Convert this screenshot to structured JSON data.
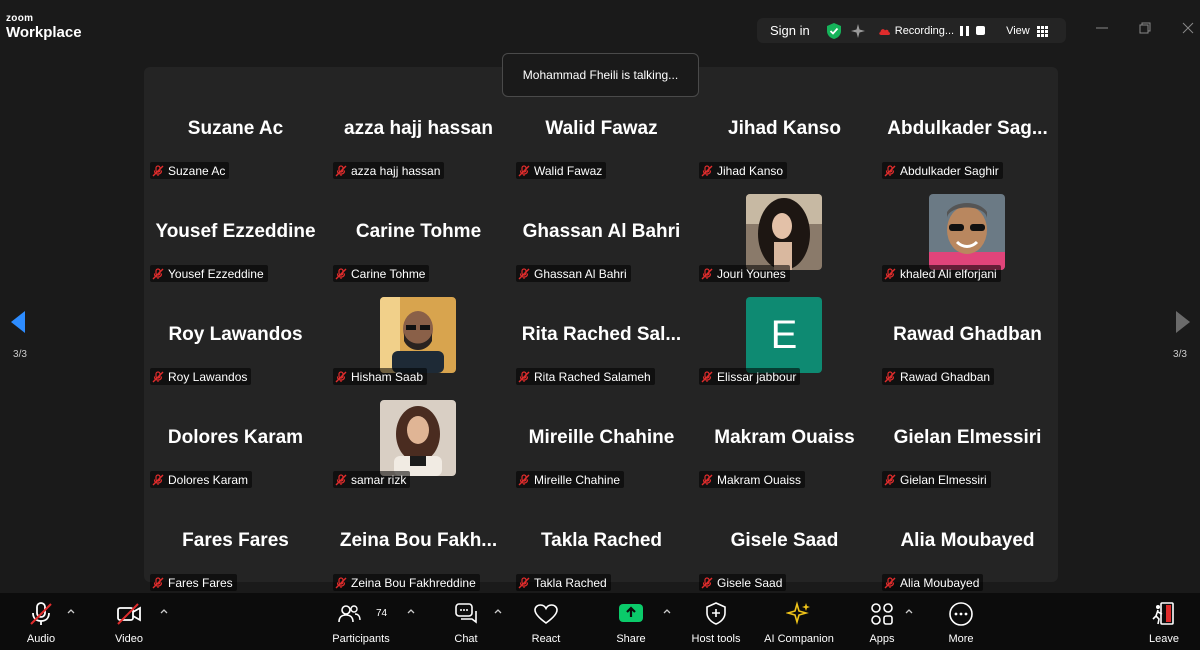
{
  "app": {
    "brand_small": "zoom",
    "brand_large": "Workplace"
  },
  "topbar": {
    "signin": "Sign in",
    "recording": "Recording...",
    "view": "View"
  },
  "talking_banner": "Mohammad Fheili is talking...",
  "pagination": {
    "left": "3/3",
    "right": "3/3"
  },
  "participants": [
    {
      "big": "Suzane Ac",
      "label": "Suzane Ac"
    },
    {
      "big": "azza hajj hassan",
      "label": "azza hajj hassan"
    },
    {
      "big": "Walid Fawaz",
      "label": "Walid Fawaz"
    },
    {
      "big": "Jihad Kanso",
      "label": "Jihad Kanso"
    },
    {
      "big": "Abdulkader Sag...",
      "label": "Abdulkader Saghir"
    },
    {
      "big": "Yousef Ezzeddine",
      "label": "Yousef Ezzeddine"
    },
    {
      "big": "Carine Tohme",
      "label": "Carine Tohme"
    },
    {
      "big": "Ghassan Al Bahri",
      "label": "Ghassan Al Bahri"
    },
    {
      "big": "",
      "label": "Jouri Younes",
      "avatar": "photo-woman-dark-hair"
    },
    {
      "big": "",
      "label": "khaled Ali elforjani",
      "avatar": "photo-man-sunglasses"
    },
    {
      "big": "Roy Lawandos",
      "label": "Roy Lawandos"
    },
    {
      "big": "",
      "label": "Hisham Saab",
      "avatar": "photo-man-beard"
    },
    {
      "big": "Rita Rached Sal...",
      "label": "Rita Rached Salameh"
    },
    {
      "big": "",
      "label": "Elissar jabbour",
      "avatar_letter": "E"
    },
    {
      "big": "Rawad Ghadban",
      "label": "Rawad Ghadban"
    },
    {
      "big": "Dolores Karam",
      "label": "Dolores Karam"
    },
    {
      "big": "",
      "label": "samar rizk",
      "avatar": "photo-woman-brown-hair"
    },
    {
      "big": "Mireille Chahine",
      "label": "Mireille Chahine"
    },
    {
      "big": "Makram Ouaiss",
      "label": "Makram Ouaiss"
    },
    {
      "big": "Gielan Elmessiri",
      "label": "Gielan Elmessiri"
    },
    {
      "big": "Fares Fares",
      "label": "Fares Fares"
    },
    {
      "big": "Zeina Bou Fakh...",
      "label": "Zeina Bou Fakhreddine"
    },
    {
      "big": "Takla Rached",
      "label": "Takla Rached"
    },
    {
      "big": "Gisele Saad",
      "label": "Gisele Saad"
    },
    {
      "big": "Alia Moubayed",
      "label": "Alia Moubayed"
    }
  ],
  "toolbar": {
    "audio": "Audio",
    "video": "Video",
    "participants": "Participants",
    "participants_count": "74",
    "chat": "Chat",
    "react": "React",
    "share": "Share",
    "host_tools": "Host tools",
    "ai_companion": "AI Companion",
    "apps": "Apps",
    "more": "More",
    "leave": "Leave"
  },
  "colors": {
    "share_green": "#0bcb6a",
    "shield_green": "#16b35a",
    "muted_red": "#e02c2c",
    "avatar_e": "#0e8a72",
    "nav_blue": "#2d8cff",
    "leave_red": "#e02c2c"
  }
}
